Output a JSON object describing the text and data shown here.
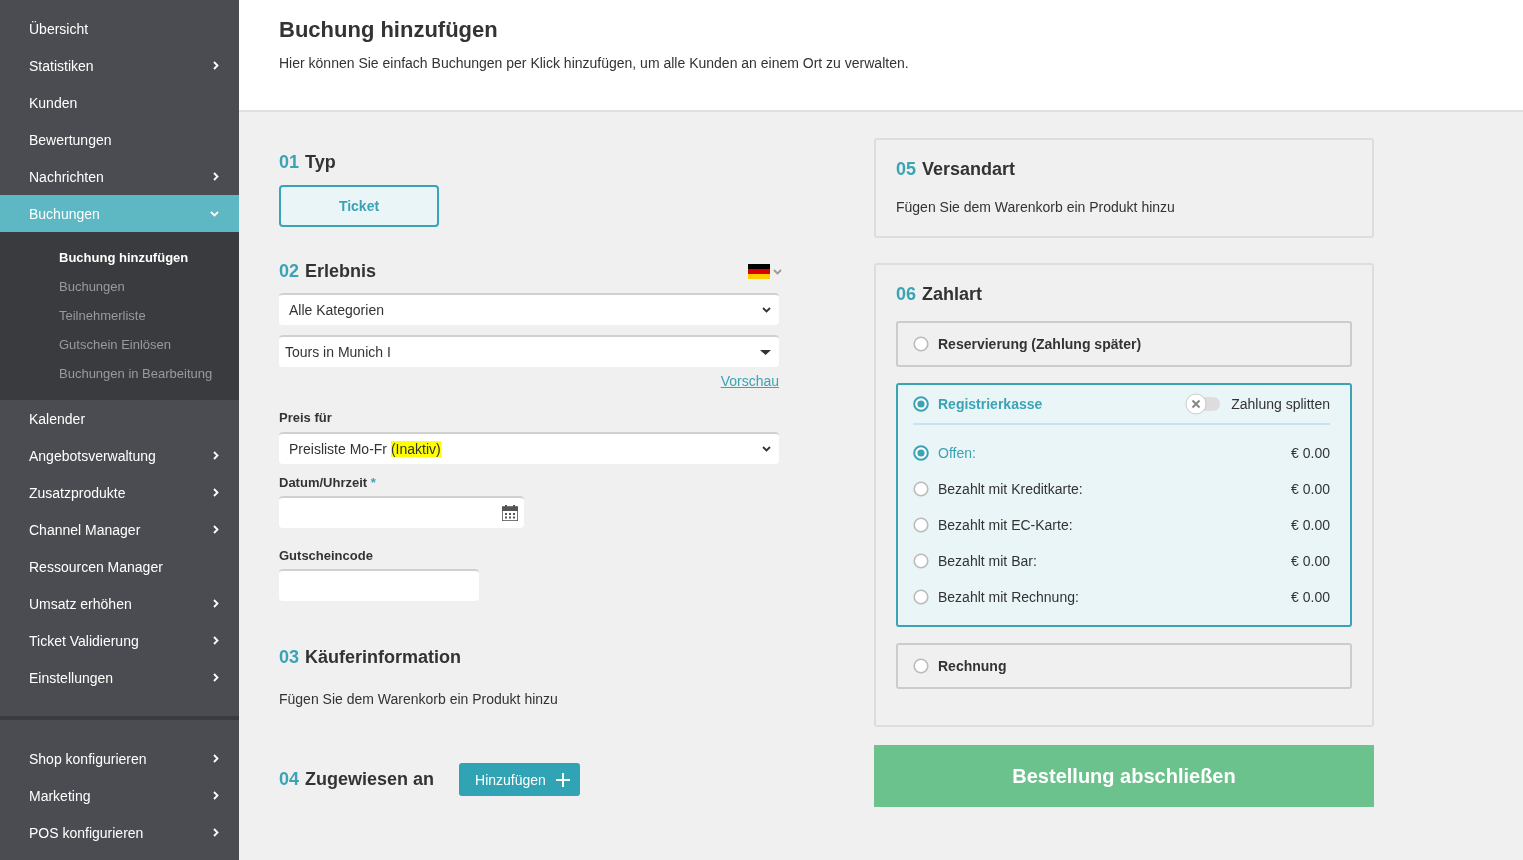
{
  "sidebar": {
    "groups": [
      {
        "items": [
          {
            "label": "Übersicht",
            "submenu": false,
            "selected": false
          },
          {
            "label": "Statistiken",
            "submenu": true,
            "expanded": false,
            "selected": false
          },
          {
            "label": "Kunden",
            "submenu": false,
            "selected": false
          },
          {
            "label": "Bewertungen",
            "submenu": false,
            "selected": false
          },
          {
            "label": "Nachrichten",
            "submenu": true,
            "expanded": false,
            "selected": false
          },
          {
            "label": "Buchungen",
            "submenu": true,
            "expanded": true,
            "selected": true,
            "children": [
              {
                "label": "Buchung hinzufügen",
                "selected": true
              },
              {
                "label": "Buchungen",
                "selected": false
              },
              {
                "label": "Teilnehmerliste",
                "selected": false
              },
              {
                "label": "Gutschein Einlösen",
                "selected": false
              },
              {
                "label": "Buchungen in Bearbeitung",
                "selected": false
              }
            ]
          },
          {
            "label": "Kalender",
            "submenu": false,
            "selected": false
          },
          {
            "label": "Angebotsverwaltung",
            "submenu": true,
            "expanded": false,
            "selected": false
          },
          {
            "label": "Zusatzprodukte",
            "submenu": true,
            "expanded": false,
            "selected": false
          },
          {
            "label": "Channel Manager",
            "submenu": true,
            "expanded": false,
            "selected": false
          },
          {
            "label": "Ressourcen Manager",
            "submenu": false,
            "selected": false
          },
          {
            "label": "Umsatz erhöhen",
            "submenu": true,
            "expanded": false,
            "selected": false
          },
          {
            "label": "Ticket Validierung",
            "submenu": true,
            "expanded": false,
            "selected": false
          },
          {
            "label": "Einstellungen",
            "submenu": true,
            "expanded": false,
            "selected": false
          }
        ]
      },
      {
        "items": [
          {
            "label": "Shop konfigurieren",
            "submenu": true,
            "expanded": false,
            "selected": false
          },
          {
            "label": "Marketing",
            "submenu": true,
            "expanded": false,
            "selected": false
          },
          {
            "label": "POS konfigurieren",
            "submenu": true,
            "expanded": false,
            "selected": false
          }
        ]
      }
    ]
  },
  "header": {
    "title": "Buchung hinzufügen",
    "description": "Hier können Sie einfach Buchungen per Klick hinzufügen, um alle Kunden an einem Ort zu verwalten."
  },
  "type_section": {
    "number": "01",
    "title": "Typ",
    "options": [
      {
        "label": "Ticket",
        "selected": true
      }
    ]
  },
  "experience_section": {
    "number": "02",
    "title": "Erlebnis",
    "category_select": {
      "value": "Alle Kategorien"
    },
    "tour_select": {
      "value": "Tours in Munich I"
    },
    "preview_link": "Vorschau",
    "price_label": "Preis für",
    "price_select": {
      "value": "Preisliste Mo-Fr",
      "highlighted": "(Inaktiv)"
    },
    "date_label": "Datum/Uhrzeit",
    "required_mark": "*",
    "voucher_label": "Gutscheincode"
  },
  "buyer_section": {
    "number": "03",
    "title": "Käuferinformation",
    "text": "Fügen Sie dem Warenkorb ein Produkt hinzu"
  },
  "assigned_section": {
    "number": "04",
    "title": "Zugewiesen an",
    "button": "Hinzufügen"
  },
  "shipping_section": {
    "number": "05",
    "title": "Versandart",
    "text": "Fügen Sie dem Warenkorb ein Produkt hinzu"
  },
  "payment_section": {
    "number": "06",
    "title": "Zahlart",
    "options": [
      {
        "kind": "simple",
        "label": "Reservierung (Zahlung später)",
        "selected": false
      },
      {
        "kind": "register",
        "label": "Registrierkasse",
        "selected": true,
        "split": {
          "label": "Zahlung splitten",
          "on": false
        },
        "entries": [
          {
            "label": "Offen:",
            "amount": "€ 0.00",
            "selected": true
          },
          {
            "label": "Bezahlt mit Kreditkarte:",
            "amount": "€ 0.00",
            "selected": false
          },
          {
            "label": "Bezahlt mit EC-Karte:",
            "amount": "€ 0.00",
            "selected": false
          },
          {
            "label": "Bezahlt mit Bar:",
            "amount": "€ 0.00",
            "selected": false
          },
          {
            "label": "Bezahlt mit Rechnung:",
            "amount": "€ 0.00",
            "selected": false
          }
        ]
      },
      {
        "kind": "simple",
        "label": "Rechnung",
        "selected": false
      }
    ]
  },
  "submit_button": "Bestellung abschließen"
}
